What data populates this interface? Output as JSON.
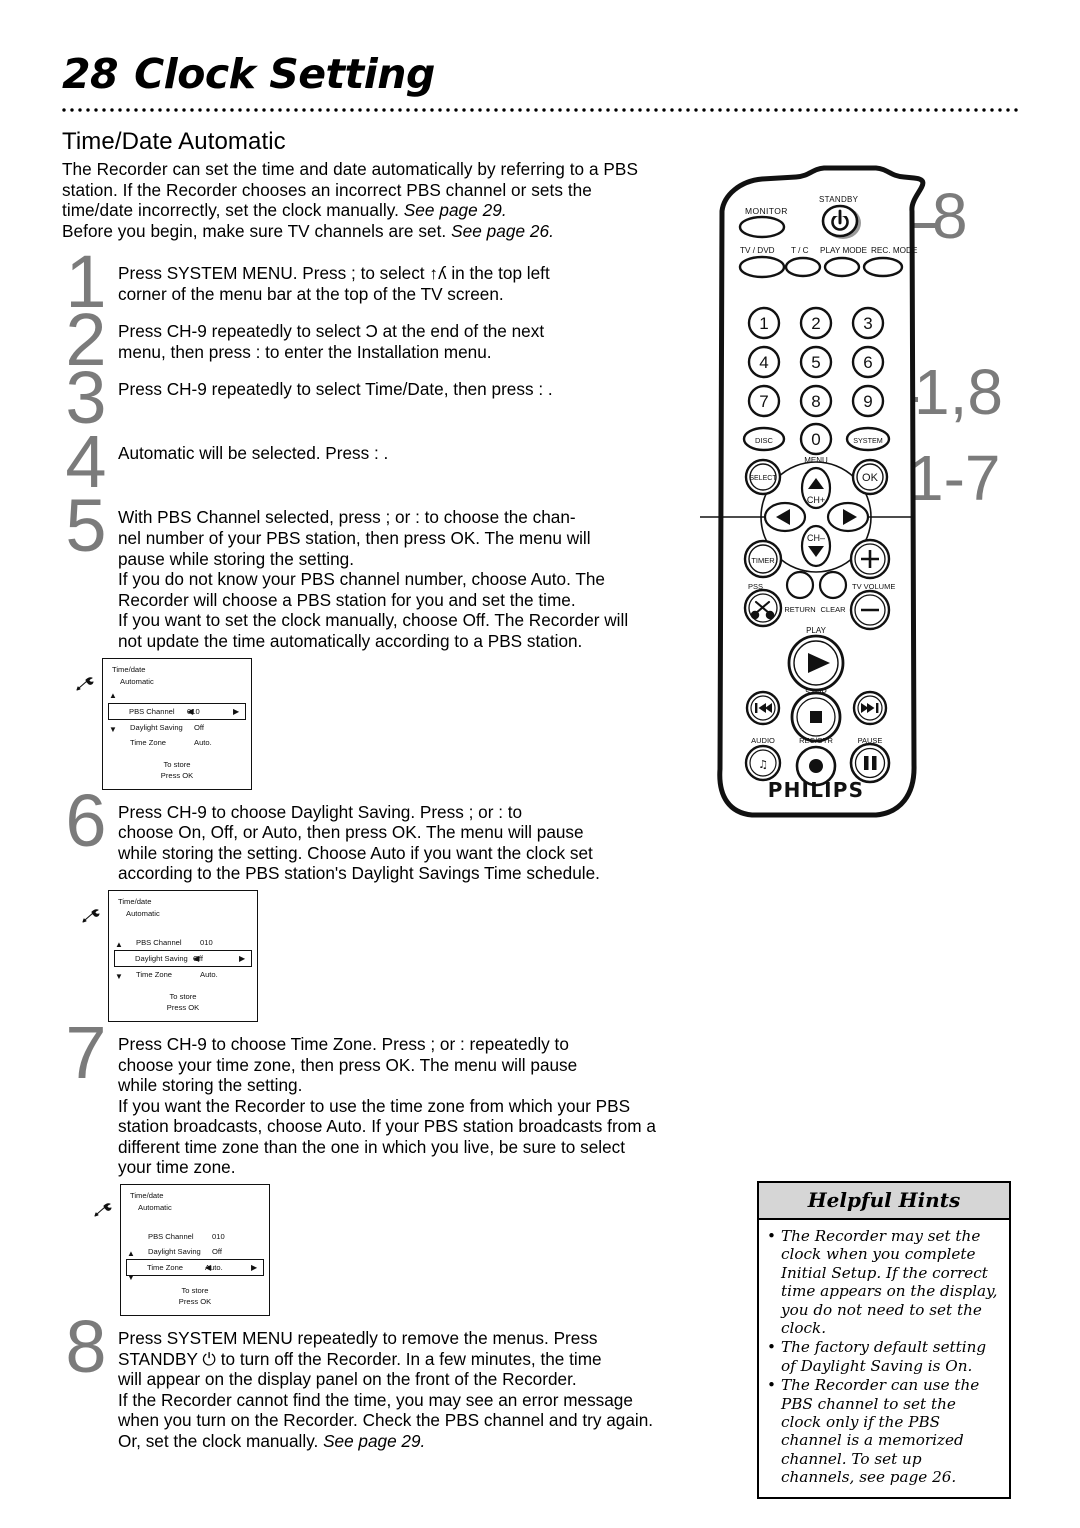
{
  "header": {
    "page_number": "28",
    "title": "Clock Setting"
  },
  "section": {
    "title": "Time/Date Automatic",
    "intro_lines": [
      "The Recorder can set the time and date automatically by referring to a PBS",
      "station. If the Recorder chooses an incorrect PBS channel or sets the",
      "time/date incorrectly, set the clock manually. ",
      "Before you begin, make sure TV channels are set. "
    ],
    "intro_italic_3": "See page 29.",
    "intro_italic_4": "See page 26."
  },
  "steps": [
    {
      "number": "1",
      "lines": [
        "Press SYSTEM MENU. Press ; to select ↑ʎ in the top left",
        "corner of the menu bar at the top of the TV screen."
      ]
    },
    {
      "number": "2",
      "lines": [
        "Press CH-9 repeatedly to select Ɔ at the end of the next",
        "menu, then press : to enter the Installation menu."
      ]
    },
    {
      "number": "3",
      "lines": [
        "Press CH-9 repeatedly to select Time/Date, then press : ."
      ]
    },
    {
      "number": "4",
      "lines": [
        "Automatic will be selected. Press : ."
      ]
    },
    {
      "number": "5",
      "lines": [
        "With PBS Channel selected, press ; or : to choose the chan-",
        "nel number of your PBS station, then press OK.    The menu will",
        "pause while storing the setting.",
        "If you do not know your PBS channel number, choose Auto. The",
        "Recorder will choose a PBS station for you and set the time.",
        "If you want to set the clock manually, choose Off. The Recorder will",
        "not update the time automatically according to a PBS station."
      ]
    },
    {
      "number": "6",
      "lines": [
        "Press CH-9 to choose Daylight Saving. Press ; or : to",
        "choose On, Off, or Auto, then press OK.    The menu will pause",
        "while storing the setting. Choose Auto if you want the clock set",
        "according to the PBS station's Daylight Savings Time schedule."
      ]
    },
    {
      "number": "7",
      "lines": [
        "Press CH-9 to choose Time Zone. Press ; or : repeatedly to",
        "choose your time zone, then press OK.    The menu will pause",
        "while storing the setting.",
        "If you want the Recorder to use the time zone from which your PBS",
        "station broadcasts, choose Auto. If your PBS station broadcasts from a",
        "different time zone than the one in which you live, be sure to select",
        "your time zone."
      ]
    },
    {
      "number": "8",
      "lines": [
        "Press SYSTEM MENU repeatedly to remove the menus. Press",
        "STANDBY ⏻ to turn off the Recorder.    In a few minutes, the time",
        "will appear on the display panel on the front of the Recorder.",
        "If the Recorder cannot find the time, you may see an error message",
        "when you turn on the Recorder. Check the PBS channel and try again.",
        "Or, set the clock manually. "
      ],
      "italic_tail": "See page 29."
    }
  ],
  "osd_screens": [
    {
      "title": "Time/date",
      "subtitle": "Automatic",
      "rows": [
        {
          "label": "PBS Channel",
          "value": "010",
          "selected": true
        },
        {
          "label": "Daylight Saving",
          "value": "Off",
          "selected": false
        },
        {
          "label": "Time Zone",
          "value": "Auto.",
          "selected": false
        }
      ],
      "up_arrow_row": 0,
      "down_arrow_row": 1,
      "footer_line1": "To store",
      "footer_line2": "Press OK"
    },
    {
      "title": "Time/date",
      "subtitle": "Automatic",
      "rows": [
        {
          "label": "PBS Channel",
          "value": "010",
          "selected": false
        },
        {
          "label": "Daylight Saving",
          "value": "Off",
          "selected": true
        },
        {
          "label": "Time Zone",
          "value": "Auto.",
          "selected": false
        }
      ],
      "up_arrow_row": 0,
      "down_arrow_row": 2,
      "footer_line1": "To store",
      "footer_line2": "Press OK"
    },
    {
      "title": "Time/date",
      "subtitle": "Automatic",
      "rows": [
        {
          "label": "PBS Channel",
          "value": "010",
          "selected": false
        },
        {
          "label": "Daylight Saving",
          "value": "Off",
          "selected": false
        },
        {
          "label": "Time Zone",
          "value": "Auto.",
          "selected": true
        }
      ],
      "up_arrow_row": 1,
      "down_arrow_row": 3,
      "footer_line1": "To store",
      "footer_line2": "Press OK"
    }
  ],
  "remote": {
    "brand": "PHILIPS",
    "labels": {
      "monitor": "MONITOR",
      "standby": "STANDBY",
      "tv_dvd": "TV / DVD",
      "t_c": "T / C",
      "play_mode": "PLAY MODE",
      "rec_mode": "REC. MODE",
      "disc": "DISC",
      "system": "SYSTEM",
      "menu": "MENU",
      "select": "SELECT",
      "ok": "OK",
      "ch_plus": "CH+",
      "ch_minus": "CH–",
      "timer": "TIMER",
      "pss": "PSS",
      "return": "RETURN",
      "clear": "CLEAR",
      "tv_volume": "TV VOLUME",
      "play": "PLAY",
      "stop": "STOP",
      "audio": "AUDIO",
      "rec_otr": "REC/OTR",
      "pause": "PAUSE"
    },
    "keypad": [
      "1",
      "2",
      "3",
      "4",
      "5",
      "6",
      "7",
      "8",
      "9",
      "0"
    ],
    "callouts": [
      {
        "id": "standby-callout",
        "text": "8"
      },
      {
        "id": "system-callout",
        "text": "1,8"
      },
      {
        "id": "cursor-callout",
        "text": "1-7"
      }
    ]
  },
  "hints": {
    "title": "Helpful Hints",
    "items": [
      "The Recorder may set the clock when you complete Initial Setup. If the correct time appears on the display, you do not need to set the clock.",
      "The factory default setting of Daylight Saving is On.",
      "The Recorder can use the PBS channel to set the clock only if the PBS channel is a memorized channel. To set up channels, see page 26."
    ]
  },
  "colors": {
    "step_number_gray": "#7b7b7b",
    "hints_header_gray": "#d6d6d6",
    "ink": "#000000"
  }
}
